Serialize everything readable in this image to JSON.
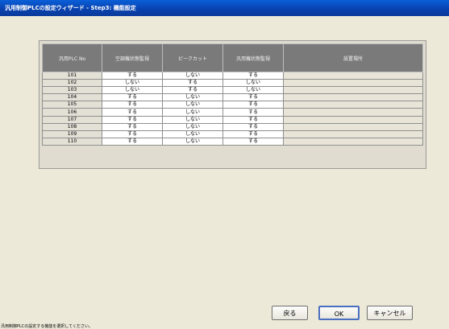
{
  "window": {
    "title": "汎用制御PLCの設定ウィザード - Step3: 機能設定"
  },
  "table": {
    "headers": [
      "汎用PLC No",
      "空調機状態監視",
      "ピークカット",
      "汎用機状態監視",
      "設置場所"
    ],
    "rows": [
      {
        "no": "101",
        "a": "する",
        "b": "しない",
        "c": "する",
        "loc": ""
      },
      {
        "no": "102",
        "a": "しない",
        "b": "する",
        "c": "しない",
        "loc": ""
      },
      {
        "no": "103",
        "a": "しない",
        "b": "する",
        "c": "しない",
        "loc": ""
      },
      {
        "no": "104",
        "a": "する",
        "b": "しない",
        "c": "する",
        "loc": ""
      },
      {
        "no": "105",
        "a": "する",
        "b": "しない",
        "c": "する",
        "loc": ""
      },
      {
        "no": "106",
        "a": "する",
        "b": "しない",
        "c": "する",
        "loc": ""
      },
      {
        "no": "107",
        "a": "する",
        "b": "しない",
        "c": "する",
        "loc": ""
      },
      {
        "no": "108",
        "a": "する",
        "b": "しない",
        "c": "する",
        "loc": ""
      },
      {
        "no": "109",
        "a": "する",
        "b": "しない",
        "c": "する",
        "loc": ""
      },
      {
        "no": "110",
        "a": "する",
        "b": "しない",
        "c": "する",
        "loc": ""
      }
    ]
  },
  "buttons": {
    "back": "戻る",
    "ok": "OK",
    "cancel": "キャンセル"
  },
  "status": {
    "hint": "汎用制御PLCの設定する機能を選択してください。"
  },
  "colors": {
    "titlebar": "#0842b0",
    "header_bg": "#7a7a7a",
    "window_bg": "#ece9d8"
  }
}
